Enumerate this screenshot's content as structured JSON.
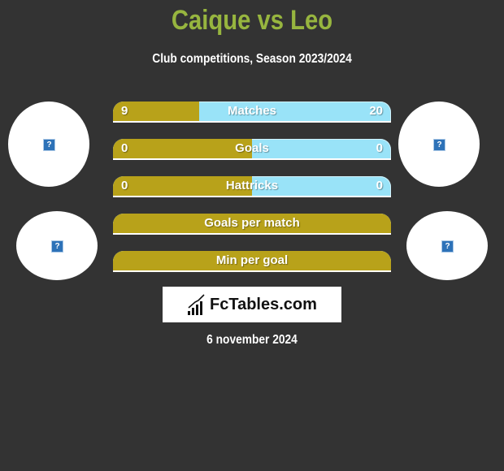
{
  "header": {
    "title": "Caique vs Leo",
    "subtitle": "Club competitions, Season 2023/2024"
  },
  "players": {
    "left": {
      "name": "Caique",
      "avatar_icon": "broken-image-icon",
      "club_icon": "broken-image-icon"
    },
    "right": {
      "name": "Leo",
      "avatar_icon": "broken-image-icon",
      "club_icon": "broken-image-icon"
    }
  },
  "colors": {
    "title": "#97b53f",
    "left_bar": "#b8a21a",
    "right_bar": "#99e3f8",
    "background": "#333333"
  },
  "stats": [
    {
      "label": "Matches",
      "left": "9",
      "right": "20",
      "left_share": 0.31
    },
    {
      "label": "Goals",
      "left": "0",
      "right": "0",
      "left_share": 0.5
    },
    {
      "label": "Hattricks",
      "left": "0",
      "right": "0",
      "left_share": 0.5
    },
    {
      "label": "Goals per match",
      "left": "",
      "right": "",
      "left_share": 1.0
    },
    {
      "label": "Min per goal",
      "left": "",
      "right": "",
      "left_share": 1.0
    }
  ],
  "logo": {
    "text": "FcTables.com",
    "icon": "bar-chart-icon"
  },
  "date": "6 november 2024",
  "placeholder_glyph": "?"
}
